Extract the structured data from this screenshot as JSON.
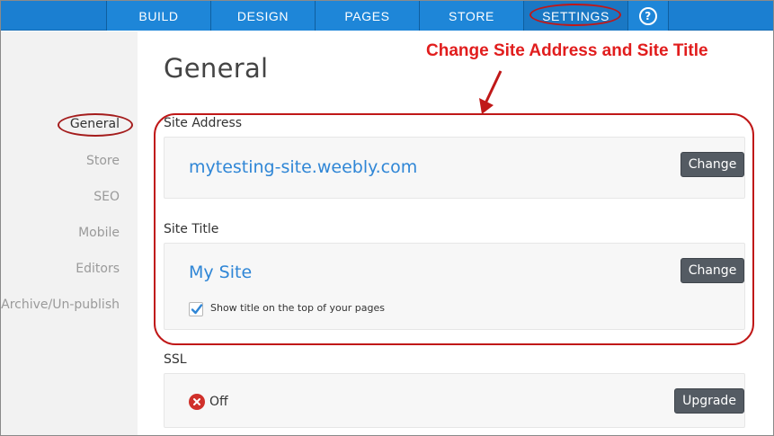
{
  "nav": {
    "items": [
      {
        "label": "BUILD"
      },
      {
        "label": "DESIGN"
      },
      {
        "label": "PAGES"
      },
      {
        "label": "STORE"
      },
      {
        "label": "SETTINGS"
      }
    ],
    "help_glyph": "?",
    "active": "SETTINGS"
  },
  "sidebar": {
    "items": [
      {
        "label": "General"
      },
      {
        "label": "Store"
      },
      {
        "label": "SEO"
      },
      {
        "label": "Mobile"
      },
      {
        "label": "Editors"
      },
      {
        "label": "Archive/Un-publish"
      }
    ]
  },
  "main": {
    "title": "General",
    "annotation": "Change Site Address and Site Title",
    "site_address": {
      "label": "Site Address",
      "value": "mytesting-site.weebly.com",
      "button": "Change"
    },
    "site_title": {
      "label": "Site Title",
      "value": "My Site",
      "button": "Change",
      "checkbox_label": "Show title on the top of your pages",
      "checkbox_checked": true
    },
    "ssl": {
      "label": "SSL",
      "status": "Off",
      "button": "Upgrade"
    }
  },
  "colors": {
    "nav_bg": "#1b7fd1",
    "link_blue": "#2f86d6",
    "annotation_red": "#e11d1d",
    "button_dark": "#545b63",
    "off_red": "#d0302a"
  },
  "icons": {
    "help": "help-circle-icon",
    "checkbox": "checkmark-icon",
    "ssl_off": "x-circle-icon",
    "annotation_arrow": "arrow-down-icon"
  }
}
